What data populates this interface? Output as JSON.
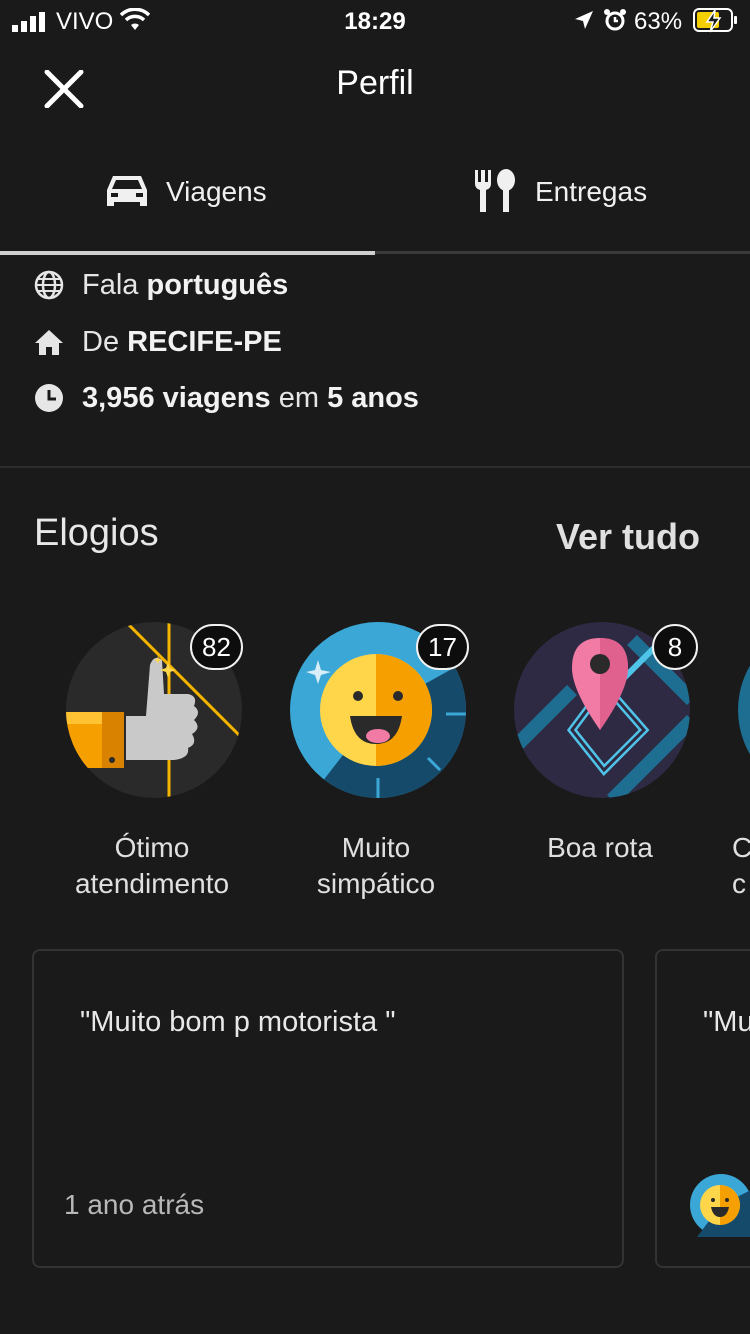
{
  "status_bar": {
    "carrier": "VIVO",
    "time": "18:29",
    "battery": "63%"
  },
  "header": {
    "title": "Perfil",
    "close_icon": "close-icon"
  },
  "tabs": [
    {
      "label": "Viagens",
      "icon": "car-icon",
      "active": true
    },
    {
      "label": "Entregas",
      "icon": "fork-knife-icon",
      "active": false
    }
  ],
  "info": {
    "language_prefix": "Fala",
    "language": "português",
    "origin_prefix": "De",
    "origin": "RECIFE-PE",
    "trips": "3,956 viagens",
    "trips_mid": "em",
    "years": "5 anos"
  },
  "compliments": {
    "title": "Elogios",
    "see_all": "Ver tudo",
    "items": [
      {
        "label_line1": "Ótimo",
        "label_line2": "atendimento",
        "count": "82"
      },
      {
        "label_line1": "Muito",
        "label_line2": "simpático",
        "count": "17"
      },
      {
        "label_line1": "Boa rota",
        "label_line2": "",
        "count": "8"
      },
      {
        "label_line1": "C",
        "label_line2": "c",
        "count": ""
      }
    ]
  },
  "comments": [
    {
      "text": "\"Muito bom p motorista \"",
      "time": "1 ano atrás"
    },
    {
      "text": "\"Mu",
      "time": ""
    }
  ],
  "colors": {
    "background": "#1a1a1a",
    "accent_yellow": "#f5b400",
    "blue": "#3aa7d6",
    "pink": "#f27ba5"
  }
}
